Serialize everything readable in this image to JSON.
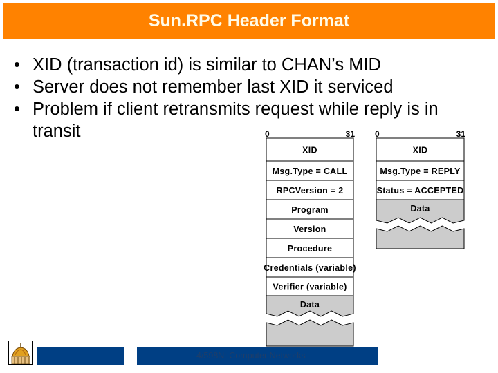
{
  "slide": {
    "title": "Sun.RPC Header Format",
    "bullets": [
      {
        "text": "XID (transaction id) is similar to CHAN’s MID"
      },
      {
        "text": "Server does not remember last XID it serviced"
      },
      {
        "text": "Problem if client retransmits request while reply is in",
        "continuation": "transit"
      }
    ],
    "bullet_glyph": "•"
  },
  "diagram": {
    "call_message": {
      "bit_start": "0",
      "bit_end": "31",
      "fields": [
        {
          "label": "XID",
          "shaded": false
        },
        {
          "label": "Msg.Type = CALL",
          "shaded": false
        },
        {
          "label": "RPCVersion = 2",
          "shaded": false
        },
        {
          "label": "Program",
          "shaded": false
        },
        {
          "label": "Version",
          "shaded": false
        },
        {
          "label": "Procedure",
          "shaded": false
        },
        {
          "label": "Credentials (variable)",
          "shaded": false
        },
        {
          "label": "Verifier (variable)",
          "shaded": false
        },
        {
          "label": "Data",
          "shaded": true
        }
      ]
    },
    "reply_message": {
      "bit_start": "0",
      "bit_end": "31",
      "fields": [
        {
          "label": "XID",
          "shaded": false
        },
        {
          "label": "Msg.Type = REPLY",
          "shaded": false
        },
        {
          "label": "Status = ACCEPTED",
          "shaded": false
        },
        {
          "label": "Data",
          "shaded": true
        }
      ]
    },
    "colors": {
      "shaded": "#cccccc",
      "stroke": "#000000"
    }
  },
  "footer": {
    "course": "4/598N: Computer Networks",
    "logo": "golden-dome-logo",
    "bar_color": "#003f84"
  },
  "colors": {
    "title_bar": "#ff8200",
    "title_text": "#fffbe8"
  }
}
